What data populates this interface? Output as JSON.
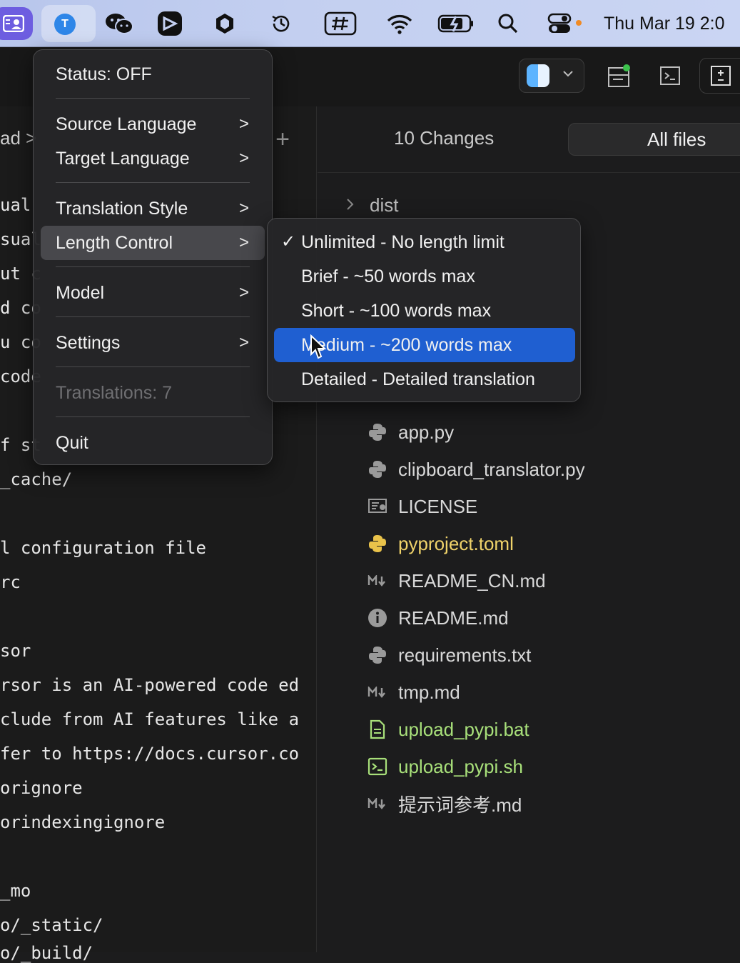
{
  "menubar": {
    "app_letter": "T",
    "clock": "Thu Mar 19  2:0",
    "icons": [
      "contacts-app-icon",
      "translator-app-icon",
      "wechat-icon",
      "capcut-icon",
      "hexagon-icon",
      "time-machine-icon",
      "hashtag-icon",
      "wifi-icon",
      "battery-charging-icon",
      "spotlight-search-icon",
      "control-center-icon"
    ]
  },
  "menu": {
    "status": "Status: OFF",
    "source_language": "Source Language",
    "target_language": "Target Language",
    "translation_style": "Translation Style",
    "length_control": "Length Control",
    "model": "Model",
    "settings": "Settings",
    "translations": "Translations: 7",
    "quit": "Quit",
    "arrow": ">"
  },
  "submenu": {
    "checkmark": "✓",
    "items": [
      "Unlimited - No length limit",
      "Brief - ~50 words max",
      "Short - ~100 words max",
      "Medium - ~200 words max",
      "Detailed - Detailed translation"
    ],
    "checked_index": 0,
    "highlighted_index": 3
  },
  "editor": {
    "breadcrumb": "ad  >",
    "plus": "+",
    "lines": [
      "ual",
      "sual",
      "ut c",
      "d co",
      "u co",
      "code",
      "",
      "f st",
      "_cache/",
      "",
      "l configuration file",
      "rc",
      "",
      "sor",
      "rsor is an AI-powered code ed",
      "clude from AI features like a",
      "fer to https://docs.cursor.co",
      "orignore",
      "orindexingignore",
      "",
      "_mo",
      "o/_static/",
      "o/_build/"
    ]
  },
  "source_control": {
    "changes": "10 Changes",
    "all_files": "All files",
    "folder": "dist",
    "files": [
      {
        "name": "app.py",
        "icon": "python-icon",
        "color": "default"
      },
      {
        "name": "clipboard_translator.py",
        "icon": "python-icon",
        "color": "default"
      },
      {
        "name": "LICENSE",
        "icon": "license-icon",
        "color": "default"
      },
      {
        "name": "pyproject.toml",
        "icon": "python-icon",
        "color": "yellow"
      },
      {
        "name": "README_CN.md",
        "icon": "markdown-icon",
        "color": "default"
      },
      {
        "name": "README.md",
        "icon": "info-icon",
        "color": "default"
      },
      {
        "name": "requirements.txt",
        "icon": "python-icon",
        "color": "default"
      },
      {
        "name": "tmp.md",
        "icon": "markdown-icon",
        "color": "default"
      },
      {
        "name": "upload_pypi.bat",
        "icon": "file-icon",
        "color": "green"
      },
      {
        "name": "upload_pypi.sh",
        "icon": "terminal-icon",
        "color": "green"
      },
      {
        "name": "提示词参考.md",
        "icon": "markdown-icon",
        "color": "default"
      }
    ]
  },
  "colors": {
    "menubar_bg": "#c3cff0",
    "highlight_blue": "#1f5fd1",
    "menu_bg": "#262628",
    "green_file": "#a8e07a",
    "yellow_file": "#f0d36a"
  }
}
